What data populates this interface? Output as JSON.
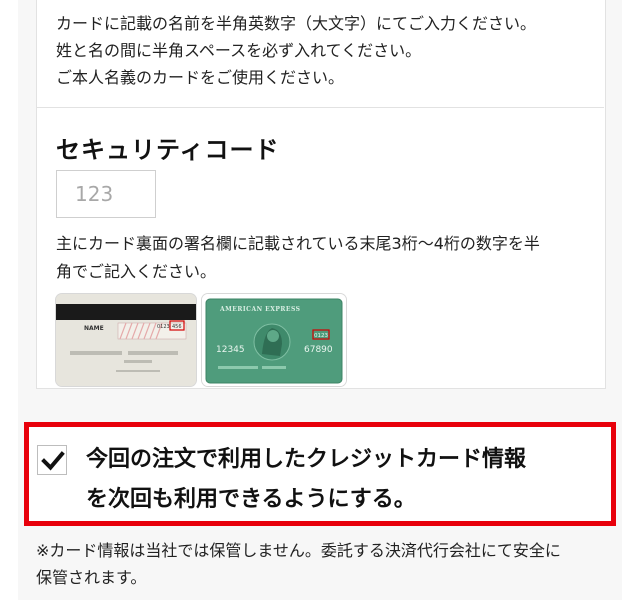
{
  "card_name": {
    "notes": [
      "カードに記載の名前を半角英数字（大文字）にてご入力ください。",
      "姓と名の間に半角スペースを必ず入れてください。",
      "ご本人名義のカードをご使用ください。"
    ]
  },
  "security_code": {
    "title": "セキュリティコード",
    "placeholder": "123",
    "help": [
      "主にカード裏面の署名欄に記載されている末尾3桁〜4桁の数字を半",
      "角でご記入ください。"
    ],
    "sample_cards": [
      {
        "icon": "card-back-sample",
        "label": "NAME",
        "code_fragment": "0123",
        "code": "456"
      },
      {
        "icon": "amex-front-sample",
        "brand": "AMERICAN EXPRESS",
        "number_left": "12345",
        "number_right": "67890",
        "code": "0123"
      }
    ]
  },
  "save_card": {
    "checked": true,
    "label_lines": [
      "今回の注文で利用したクレジットカード情報",
      "を次回も利用できるようにする。"
    ],
    "highlight_color": "#e8000b"
  },
  "footnote": [
    "※カード情報は当社では保管しません。委託する決済代行会社にて安全に",
    "保管されます。"
  ]
}
